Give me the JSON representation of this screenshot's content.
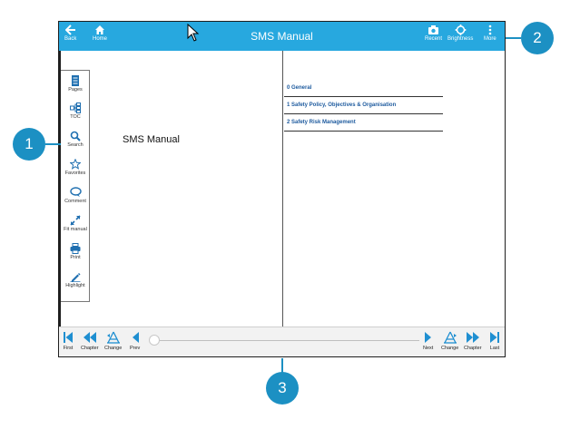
{
  "topbar": {
    "title": "SMS Manual",
    "back_label": "Back",
    "home_label": "Home",
    "recent_label": "Recent",
    "brightness_label": "Brightness",
    "more_label": "More",
    "bg_color": "#27a8df"
  },
  "sidebar": {
    "items": [
      {
        "label": "Pages",
        "icon": "pages-icon"
      },
      {
        "label": "TOC",
        "icon": "toc-icon"
      },
      {
        "label": "Search",
        "icon": "search-icon"
      },
      {
        "label": "Favorites",
        "icon": "star-icon"
      },
      {
        "label": "Comment",
        "icon": "comment-icon"
      },
      {
        "label": "Fit manual",
        "icon": "expand-icon"
      },
      {
        "label": "Print",
        "icon": "print-icon"
      },
      {
        "label": "Highlight",
        "icon": "pencil-icon"
      }
    ]
  },
  "document": {
    "title": "SMS Manual",
    "toc": [
      "0 General",
      "1 Safety Policy, Objectives & Organisation",
      "2 Safety Risk Management"
    ]
  },
  "bottombar": {
    "first_label": "First",
    "chapter_prev_label": "Chapter",
    "change_prev_label": "Change",
    "prev_label": "Prev",
    "next_label": "Next",
    "change_next_label": "Change",
    "chapter_next_label": "Chapter",
    "last_label": "Last",
    "slider_position": 0
  },
  "callouts": [
    "1",
    "2",
    "3"
  ],
  "accent_color": "#1c90c3"
}
